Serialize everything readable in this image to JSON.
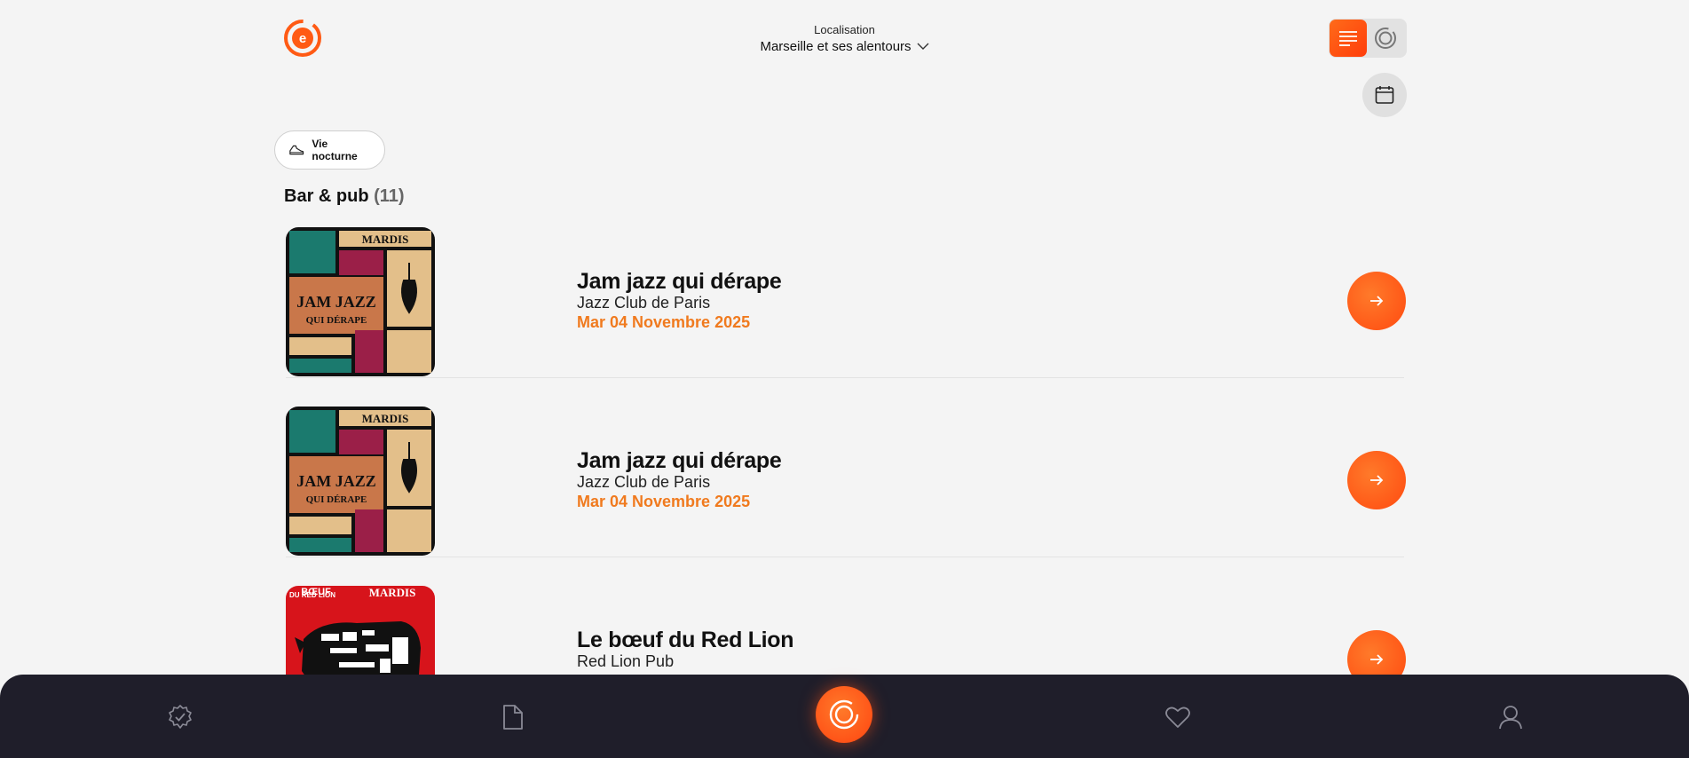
{
  "header": {
    "location_label": "Localisation",
    "location_value": "Marseille et ses alentours"
  },
  "filter": {
    "chip_label": "Vie nocturne"
  },
  "section": {
    "title": "Bar & pub",
    "count": "(11)"
  },
  "events": [
    {
      "title": "Jam jazz qui dérape",
      "venue": "Jazz Club de Paris",
      "date": "Mar 04 Novembre 2025",
      "poster_top": "MARDIS",
      "poster_main": "JAM JAZZ",
      "poster_sub": "QUI DÉRAPE"
    },
    {
      "title": "Jam jazz qui dérape",
      "venue": "Jazz Club de Paris",
      "date": "Mar 04 Novembre 2025",
      "poster_top": "MARDIS",
      "poster_main": "JAM JAZZ",
      "poster_sub": "QUI DÉRAPE"
    },
    {
      "title": "Le bœuf du Red Lion",
      "venue": "Red Lion Pub",
      "date": "",
      "poster_top": "MARDIS",
      "poster_main": "BŒUF",
      "poster_sub": "DU RED LION"
    }
  ],
  "icons": {
    "logo": "logo-icon",
    "chevron": "chevron-down-icon",
    "list_view": "list-view-icon",
    "map_view": "radar-view-icon",
    "calendar": "calendar-icon",
    "chip": "shoe-icon",
    "arrow": "arrow-right-icon",
    "nav": [
      "badge-check-icon",
      "document-icon",
      "radar-icon",
      "heart-icon",
      "user-icon"
    ]
  },
  "colors": {
    "accent": "#ff5a14",
    "date": "#f07a1e",
    "nav_bg": "#1f1e2a",
    "page_bg": "#f4f4f4"
  }
}
